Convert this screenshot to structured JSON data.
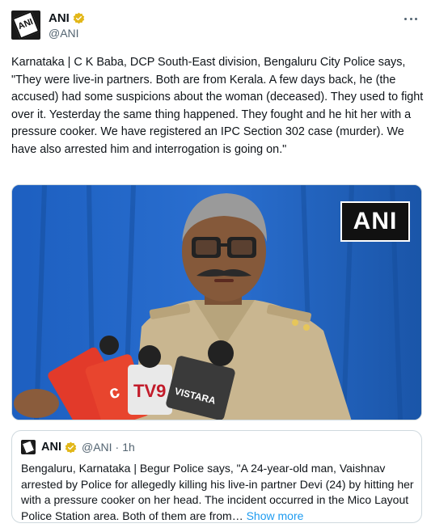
{
  "author": {
    "name": "ANI",
    "handle": "@ANI",
    "avatar_text": "ANI",
    "verified_badge_color": "#e2b719"
  },
  "tweet": {
    "text": "Karnataka | C K Baba, DCP South-East division, Bengaluru City Police says, \"They were live-in partners. Both are from Kerala. A few days back, he (the accused) had some suspicions about the woman (deceased). They used to fight over it. Yesterday the same thing happened. They fought and he hit her with a pressure cooker. We have registered an IPC Section 302 case (murder). We have also arrested him and interrogation is going on.\""
  },
  "media": {
    "watermark": "ANI",
    "mic_labels": [
      "TV9",
      "VISTARA"
    ],
    "background_color": "#1a60b8"
  },
  "quote": {
    "name": "ANI",
    "handle": "@ANI",
    "separator": "·",
    "time": "1h",
    "text": "Bengaluru, Karnataka | Begur Police says, \"A 24-year-old man, Vaishnav arrested by Police for allegedly killing his live-in partner Devi (24) by hitting her with a pressure cooker on her head. The incident occurred in the Mico Layout Police Station area. Both of them are from…",
    "show_more": "Show more"
  },
  "icons": {
    "more": "more-horizontal-icon",
    "verified": "verified-badge-icon"
  }
}
